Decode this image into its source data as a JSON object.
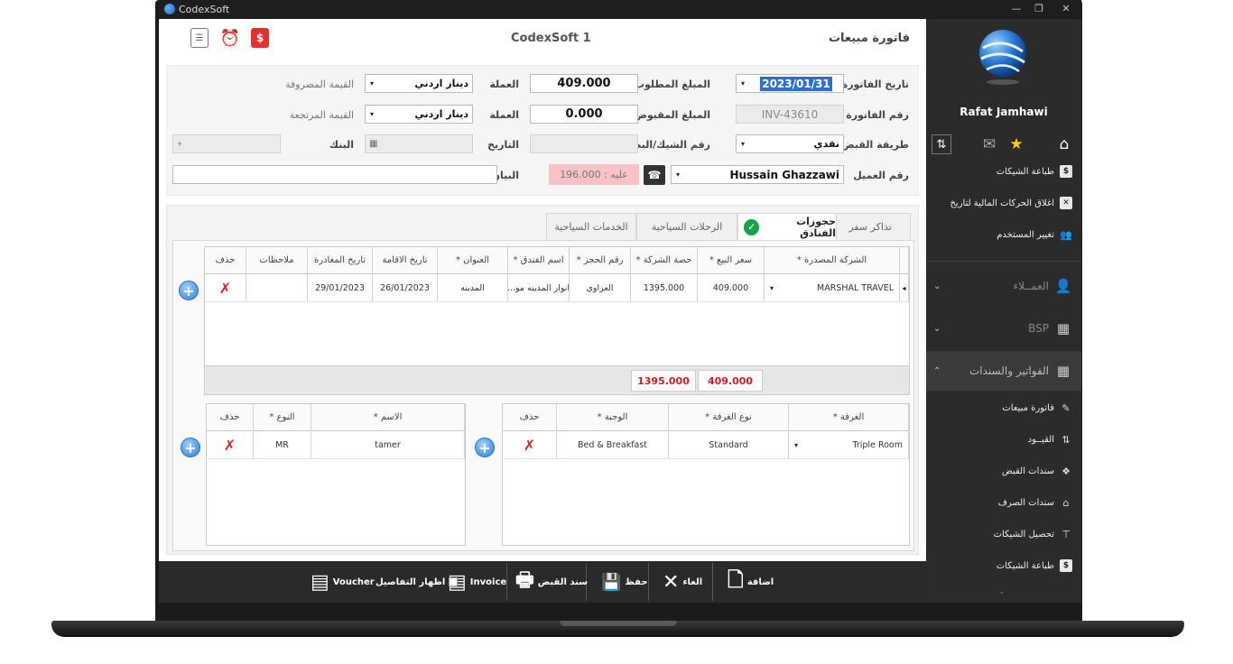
{
  "window": {
    "app_title": "CodexSoft",
    "minimize": "—",
    "restore": "❐",
    "close": "✕"
  },
  "header": {
    "title": "CodexSoft 1",
    "page_title": "فاتورة مبيعات",
    "icons": {
      "list": "☰",
      "alarm": "⏰",
      "dollar": "$"
    }
  },
  "form": {
    "invoice_date_label": "تاريخ الفاتورة",
    "invoice_date": "2023/01/31",
    "required_amount_label": "المبلغ المطلوب",
    "required_amount": "409.000",
    "currency_label_1": "العملة",
    "currency_1": "دينار اردني",
    "spent_value_label": "القيمة المصروفة",
    "invoice_no_label": "رقم الفاتورة",
    "invoice_no": "INV-43610",
    "received_amount_label": "المبلغ المقبوض",
    "received_amount": "0.000",
    "currency_label_2": "العملة",
    "currency_2": "دينار اردني",
    "returned_value_label": "القيمة المرتجعة",
    "payment_method_label": "طريقة القبض",
    "payment_method": "نقدي",
    "cheque_label": "رقم الشيك/البطاقة",
    "date_label": "التاريخ",
    "bank_label": "البنك",
    "client_no_label": "رقم العميل",
    "client_name": "Hussain Ghazzawi",
    "balance_text": "عليه : 196.000",
    "statement_label": "البيان",
    "contact_icon": "☎",
    "dropdown_arrow": "▾"
  },
  "tabs": [
    {
      "label": "تذاكر سفر"
    },
    {
      "label": "حجوزات الفنادق"
    },
    {
      "label": "الرحلات السياحية"
    },
    {
      "label": "الخدمات السياحية"
    }
  ],
  "check_icon": "✓",
  "hotel_grid": {
    "headers": [
      "الشركة المصدرة *",
      "سعر البيع *",
      "حصة الشركة *",
      "رقم الحجز *",
      "اسم الفندق *",
      "العنوان *",
      "تاريخ الاقامة",
      "تاريخ المغادرة",
      "ملاحظات",
      "حذف"
    ],
    "row": [
      "MARSHAL TRAVEL",
      "409.000",
      "1395.000",
      "العزاوي",
      "انوار المدينه مو...",
      "المدينه",
      "26/01/2023",
      "29/01/2023",
      "",
      ""
    ],
    "totals": [
      "409.000",
      "1395.000"
    ],
    "row_marker": "◂"
  },
  "rooms_grid": {
    "headers": [
      "الغرفة *",
      "نوع الغرفة *",
      "الوجبة *",
      "حذف"
    ],
    "row": [
      "Triple Room",
      "Standard",
      "Bed & Breakfast",
      ""
    ]
  },
  "guests_grid": {
    "headers": [
      "الاسم *",
      "النوع *",
      "حذف"
    ],
    "row": [
      "tamer",
      "MR",
      ""
    ]
  },
  "delete_icon": "✗",
  "add_icon": "+",
  "toolbar": {
    "add": "اضافة",
    "cancel": "الغاء",
    "save": "حفظ",
    "receipt": "سند القبض",
    "invoice": "Invoice",
    "show_details": "اظهار التفاصيل",
    "voucher": "Voucher",
    "icons": {
      "add": "🗋",
      "cancel": "✕",
      "save": "💾",
      "print": "🖶",
      "invoice": "▤",
      "voucher": "▤"
    }
  },
  "sidebar": {
    "username": "Rafat Jamhawi",
    "top_icons": {
      "home": "⌂",
      "star": "★",
      "mail": "✉",
      "sync": "⇅"
    },
    "items_top": [
      {
        "label": "طباعة الشيكات",
        "icon": "$"
      },
      {
        "label": "اغلاق الحركات المالية لتاريخ",
        "icon": "✕"
      },
      {
        "label": "تغيير المستخدم",
        "icon": "👥"
      }
    ],
    "sections": [
      {
        "label": "العمــلاء",
        "icon": "👤",
        "chevron": "⌄"
      },
      {
        "label": "BSP",
        "icon": "▦",
        "chevron": "⌄"
      },
      {
        "label": "الفواتير والسندات",
        "icon": "▦",
        "chevron": "⌃"
      }
    ],
    "items_bottom": [
      {
        "label": "فاتورة مبيعات",
        "icon": "✎"
      },
      {
        "label": "القيــود",
        "icon": "⇅"
      },
      {
        "label": "سندات القبض",
        "icon": "❖"
      },
      {
        "label": "سندات الصرف",
        "icon": "⌂"
      },
      {
        "label": "تحصيل الشيكات",
        "icon": "⊤"
      },
      {
        "label": "طباعة الشيكات",
        "icon": "$"
      }
    ],
    "more": "⌄"
  },
  "colors": {
    "accent": "#2d6fd0",
    "danger": "#e02020",
    "success": "#16a34a",
    "sidebar_bg": "#2b2b2b",
    "balance_bg": "#f7c3c6"
  }
}
